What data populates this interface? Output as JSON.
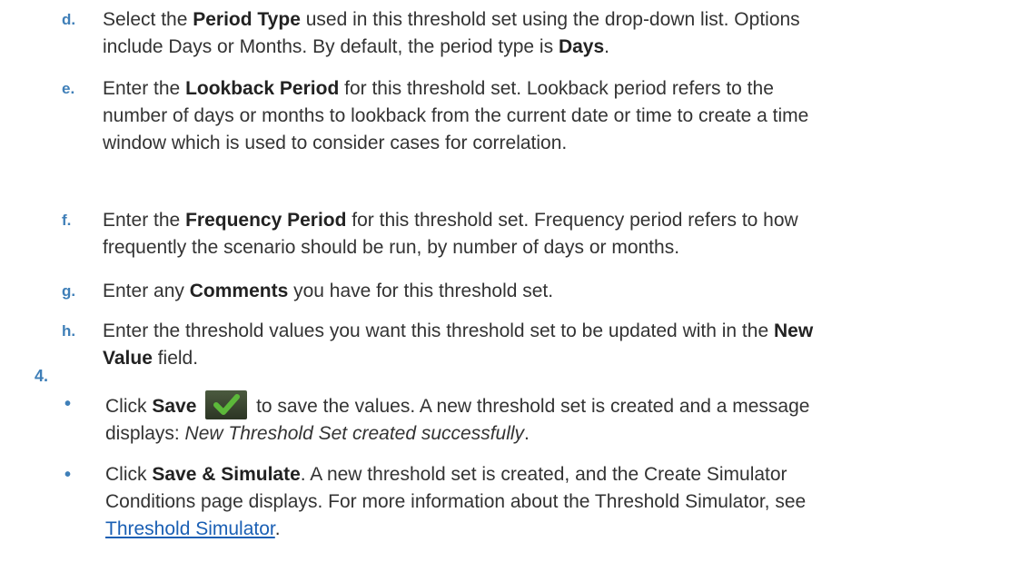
{
  "steps": [
    {
      "marker": "d.",
      "lines": [
        [
          "Select the ",
          {
            "b": "Period Type"
          },
          " used in this threshold set using the drop-down list. Options"
        ],
        [
          "include Days or Months. By default, the period type is ",
          {
            "b": "Days"
          },
          "."
        ]
      ]
    },
    {
      "marker": "e.",
      "lines": [
        [
          "Enter the ",
          {
            "b": "Lookback Period"
          },
          " for this threshold set. Lookback period refers to the"
        ],
        [
          "number of days or months to lookback from the current date or time to create a time"
        ],
        [
          "window which is used to consider cases for correlation."
        ]
      ]
    },
    {
      "marker": "f.",
      "lines": [
        [
          "Enter the ",
          {
            "b": "Frequency Period"
          },
          " for this threshold set. Frequency period refers to how"
        ],
        [
          "frequently the scenario should be run, by number of days or months."
        ]
      ]
    },
    {
      "marker": "g.",
      "lines": [
        [
          "Enter any ",
          {
            "b": "Comments"
          },
          " you have for this threshold set."
        ]
      ]
    },
    {
      "marker": "h.",
      "lines": [
        [
          "Enter the threshold values you want this threshold set to be updated with in the ",
          {
            "b": "New"
          }
        ],
        [
          {
            "b": "Value"
          },
          " field."
        ]
      ]
    }
  ],
  "step4_marker": "4.",
  "bullets": [
    {
      "marker": "•",
      "lines": [
        [
          "Click ",
          {
            "b": "Save"
          },
          " ",
          {
            "icon": "save-check-icon"
          },
          " to save the values. A new threshold set is created and a message"
        ],
        [
          "displays: ",
          {
            "i": "New Threshold Set created successfully"
          },
          "."
        ]
      ]
    },
    {
      "marker": "•",
      "lines": [
        [
          "Click ",
          {
            "b": "Save & Simulate"
          },
          ". A new threshold set is created, and the Create Simulator"
        ],
        [
          "Conditions page displays. For more information about the Threshold Simulator, see"
        ],
        [
          {
            "link": "Threshold Simulator"
          },
          "."
        ]
      ]
    }
  ],
  "colors": {
    "marker": "#3f7fb8",
    "text": "#333333",
    "link": "#1a5fb4",
    "check": "#5cb83a"
  }
}
